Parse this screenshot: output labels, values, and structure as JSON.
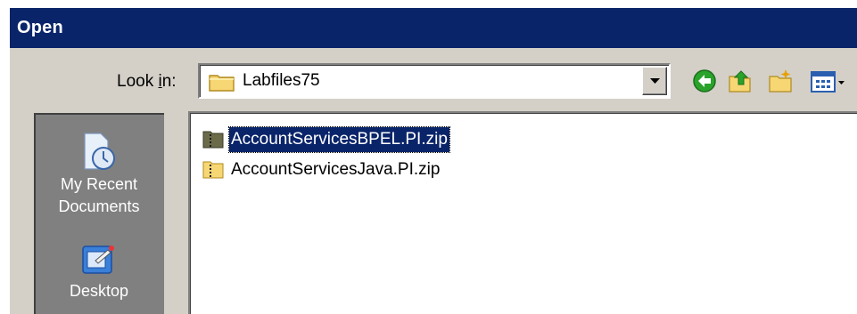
{
  "dialog": {
    "title": "Open"
  },
  "toolbar": {
    "lookin_prefix": "Look ",
    "lookin_mnemonic": "i",
    "lookin_suffix": "n:",
    "current_folder": "Labfiles75",
    "icons": [
      "back-icon",
      "up-folder-icon",
      "new-folder-icon",
      "view-menu-icon"
    ]
  },
  "places": [
    {
      "line1": "My Recent",
      "line2": "Documents",
      "icon": "recent-documents-icon"
    },
    {
      "line1": "Desktop",
      "icon": "desktop-icon"
    }
  ],
  "files": [
    {
      "name": "AccountServicesBPEL.PI.zip",
      "selected": true
    },
    {
      "name": "AccountServicesJava.PI.zip",
      "selected": false
    }
  ],
  "colors": {
    "title_bar": "#0a246a",
    "dialog_face": "#d4d0c8",
    "places_bar": "#808080",
    "selection": "#0a246a"
  }
}
